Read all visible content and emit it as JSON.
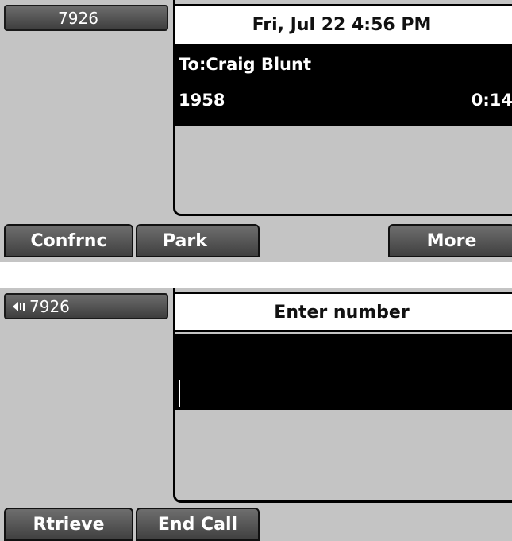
{
  "top_screen": {
    "line_key": "7926",
    "datetime": "Fri, Jul 22  4:56 PM",
    "call": {
      "to": "To:Craig Blunt",
      "number": "1958",
      "duration": "0:14"
    },
    "softkeys": [
      "Confrnc",
      "Park",
      "More"
    ]
  },
  "bottom_screen": {
    "line_key": "7926",
    "title": "Enter number",
    "softkeys": [
      "Rtrieve",
      "End Call"
    ]
  },
  "colors": {
    "screen_bg": "#c4c4c4",
    "key_gradient_top": "#6c6c6c",
    "key_gradient_bottom": "#3e3e3e",
    "call_area": "#000000"
  },
  "icons": {
    "speaker": "speaker-icon"
  }
}
